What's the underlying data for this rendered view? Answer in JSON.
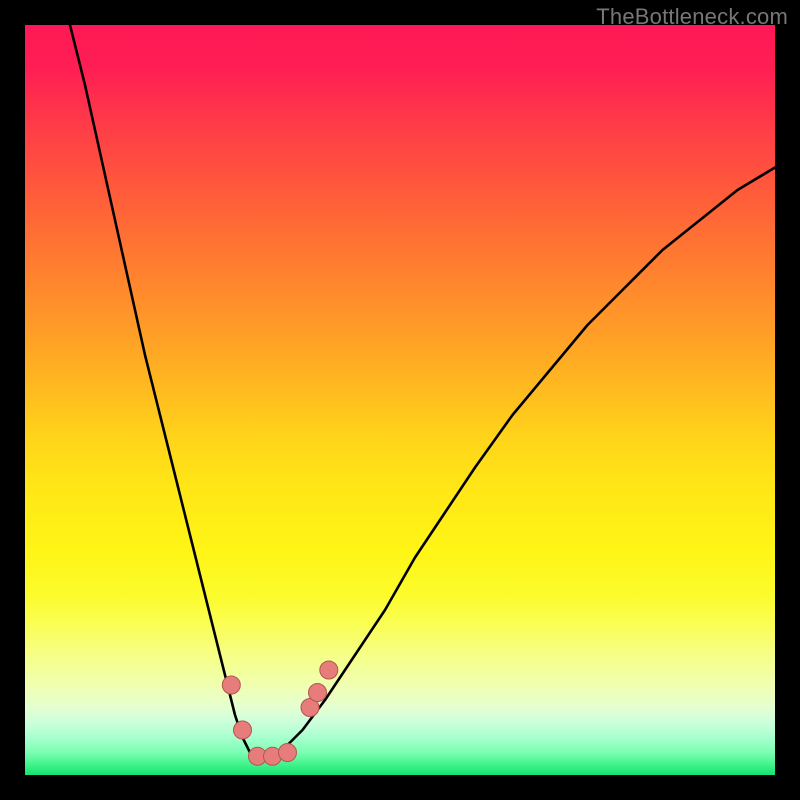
{
  "watermark": "TheBottleneck.com",
  "colors": {
    "marker": "#e77d7a",
    "marker_stroke": "#b35452",
    "curve": "#000000"
  },
  "chart_data": {
    "type": "line",
    "title": "",
    "xlabel": "",
    "ylabel": "",
    "xlim": [
      0,
      100
    ],
    "ylim": [
      0,
      100
    ],
    "grid": false,
    "series": [
      {
        "name": "bottleneck-curve",
        "x": [
          6,
          8,
          10,
          12,
          14,
          16,
          18,
          20,
          22,
          24,
          26,
          27,
          28,
          29,
          30,
          31,
          32,
          33,
          34,
          35,
          37,
          40,
          44,
          48,
          52,
          56,
          60,
          65,
          70,
          75,
          80,
          85,
          90,
          95,
          100
        ],
        "y": [
          100,
          92,
          83,
          74,
          65,
          56,
          48,
          40,
          32,
          24,
          16,
          12,
          8,
          5,
          3,
          2,
          2,
          2,
          3,
          4,
          6,
          10,
          16,
          22,
          29,
          35,
          41,
          48,
          54,
          60,
          65,
          70,
          74,
          78,
          81
        ]
      }
    ],
    "markers": [
      {
        "name": "left-upper",
        "x": 27.5,
        "y": 12
      },
      {
        "name": "left-lower",
        "x": 29.0,
        "y": 6
      },
      {
        "name": "bottom-a",
        "x": 31.0,
        "y": 2.5
      },
      {
        "name": "bottom-b",
        "x": 33.0,
        "y": 2.5
      },
      {
        "name": "bottom-c",
        "x": 35.0,
        "y": 3.0
      },
      {
        "name": "right-lower",
        "x": 38.0,
        "y": 9
      },
      {
        "name": "right-mid",
        "x": 39.0,
        "y": 11
      },
      {
        "name": "right-upper",
        "x": 40.5,
        "y": 14
      }
    ]
  }
}
